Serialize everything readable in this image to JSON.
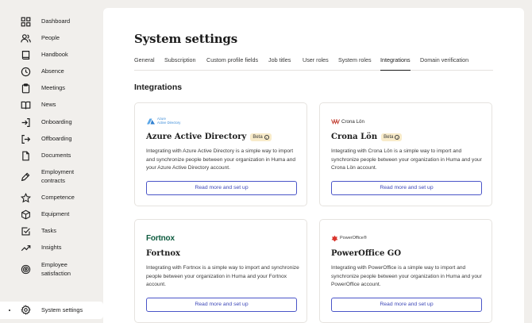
{
  "sidebar": {
    "items": [
      {
        "label": "Dashboard",
        "icon": "grid-icon"
      },
      {
        "label": "People",
        "icon": "people-icon"
      },
      {
        "label": "Handbook",
        "icon": "book-icon"
      },
      {
        "label": "Absence",
        "icon": "clock-icon"
      },
      {
        "label": "Meetings",
        "icon": "clipboard-icon"
      },
      {
        "label": "News",
        "icon": "open-book-icon"
      },
      {
        "label": "Onboarding",
        "icon": "login-icon"
      },
      {
        "label": "Offboarding",
        "icon": "logout-icon"
      },
      {
        "label": "Documents",
        "icon": "document-icon"
      },
      {
        "label": "Employment contracts",
        "label_line1": "Employment",
        "label_line2": "contracts",
        "icon": "pen-icon"
      },
      {
        "label": "Competence",
        "icon": "star-icon"
      },
      {
        "label": "Equipment",
        "icon": "box-icon"
      },
      {
        "label": "Tasks",
        "icon": "checkbox-icon"
      },
      {
        "label": "Insights",
        "icon": "trend-icon"
      },
      {
        "label": "Employee satisfaction",
        "label_line1": "Employee",
        "label_line2": "satisfaction",
        "icon": "target-icon"
      },
      {
        "label": "System settings",
        "icon": "gear-icon",
        "active": true
      }
    ]
  },
  "main": {
    "title": "System settings",
    "tabs": [
      {
        "label": "General"
      },
      {
        "label": "Subscription"
      },
      {
        "label": "Custom profile fields"
      },
      {
        "label": "Job titles"
      },
      {
        "label": "User roles"
      },
      {
        "label": "System roles"
      },
      {
        "label": "Integrations",
        "active": true
      },
      {
        "label": "Domain verification"
      }
    ],
    "section_title": "Integrations",
    "cards": [
      {
        "logo_text_line1": "Azure",
        "logo_text_line2": "Active Directory",
        "name": "Azure Active Directory",
        "badge": "Beta",
        "description": "Integrating with Azure Active Directory is a simple way to import and synchronize people between your organization in Huma and your Azure Active Directory account.",
        "button": "Read more and set up"
      },
      {
        "logo_text": "Crona Lön",
        "name": "Crona Lön",
        "badge": "Beta",
        "description": "Integrating with Crona Lön is a simple way to import and synchronize people between your organization in Huma and your Crona Lön account.",
        "button": "Read more and set up"
      },
      {
        "logo_text": "Fortnox",
        "name": "Fortnox",
        "description": "Integrating with Fortnox is a simple way to import and synchronize people between your organization in Huma and your Fortnox account.",
        "button": "Read more and set up"
      },
      {
        "logo_text": "PowerOffice®",
        "name": "PowerOffice GO",
        "description": "Integrating with PowerOffice is a simple way to import and synchronize people between your organization in Huma and your PowerOffice account.",
        "button": "Read more and set up"
      }
    ]
  },
  "colors": {
    "background": "#f1efec",
    "accent": "#3d48b8",
    "beta_badge": "#f8ebc9",
    "fortnox_green": "#0e5b3f",
    "azure_blue": "#3a8bd8",
    "poweroffice_red": "#d9352c"
  }
}
